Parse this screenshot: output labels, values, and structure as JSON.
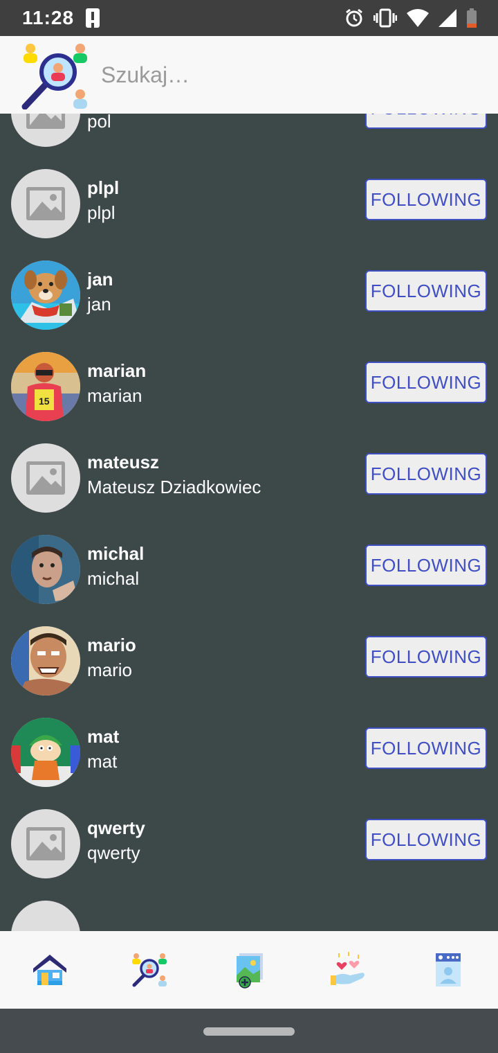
{
  "status_bar": {
    "time": "11:28"
  },
  "search": {
    "placeholder": "Szukaj…",
    "value": ""
  },
  "users": [
    {
      "username": "pol",
      "full_name": "pol",
      "button": "FOLLOWING",
      "avatar": "placeholder-image-icon"
    },
    {
      "username": "plpl",
      "full_name": "plpl",
      "button": "FOLLOWING",
      "avatar": "placeholder-image-icon"
    },
    {
      "username": "jan",
      "full_name": "jan",
      "button": "FOLLOWING",
      "avatar": "dog-photo"
    },
    {
      "username": "marian",
      "full_name": "marian",
      "button": "FOLLOWING",
      "avatar": "racer-photo"
    },
    {
      "username": "mateusz",
      "full_name": "Mateusz Dziadkowiec",
      "button": "FOLLOWING",
      "avatar": "placeholder-image-icon"
    },
    {
      "username": "michal",
      "full_name": "michal",
      "button": "FOLLOWING",
      "avatar": "man-photo"
    },
    {
      "username": "mario",
      "full_name": "mario",
      "button": "FOLLOWING",
      "avatar": "cartoon-man-photo"
    },
    {
      "username": "mat",
      "full_name": "mat",
      "button": "FOLLOWING",
      "avatar": "cartoon-kid-photo"
    },
    {
      "username": "qwerty",
      "full_name": "qwerty",
      "button": "FOLLOWING",
      "avatar": "placeholder-image-icon"
    }
  ],
  "bottom_nav": [
    {
      "icon": "home-icon"
    },
    {
      "icon": "search-people-icon"
    },
    {
      "icon": "add-photo-icon"
    },
    {
      "icon": "hearts-hand-icon"
    },
    {
      "icon": "profile-card-icon"
    }
  ],
  "colors": {
    "background": "#3d4849",
    "accent": "#3f4fc3",
    "header": "#f8f8f8"
  }
}
